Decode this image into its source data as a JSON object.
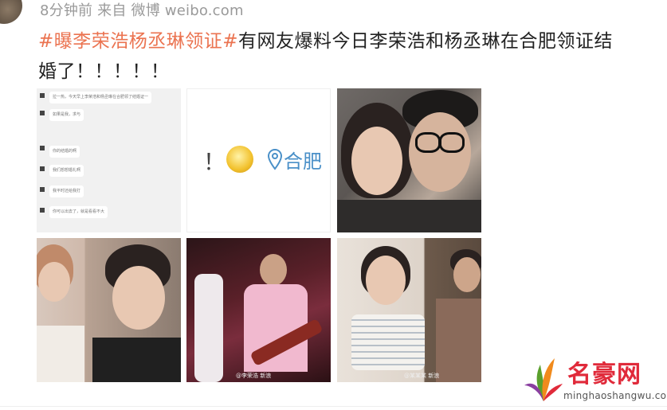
{
  "post": {
    "meta": "8分钟前 来自 微博 weibo.com",
    "hashtag": "#曝李荣浩杨丞琳领证#",
    "text": "有网友爆料今日李荣浩和杨丞琳在合肥领证结婚了！！！！！"
  },
  "images": {
    "chat": {
      "bubbles": [
        "拉一热，今天早上李荣浩和杨丞琳在合肥领了结婚证一",
        "如果是我，求与",
        "你的结婚的啊",
        "我们想想婚礼啊",
        "我平时还给我打",
        "你可以出去了，就是看看不大"
      ]
    },
    "location": {
      "exclamation": "！",
      "city": "合肥",
      "pin_icon": "location-pin-icon",
      "emoji_icon": "crying-laughing-emoji-icon"
    },
    "stage_watermark": "@李荣浩 新浪",
    "right_watermark": "@某某某 新浪"
  },
  "logo": {
    "name": "名豪网",
    "url": "minghaoshangwu.com",
    "colors": {
      "red": "#e02a3a",
      "green": "#5aa02c",
      "orange": "#f08a1c",
      "purple": "#8a3fa0"
    }
  }
}
